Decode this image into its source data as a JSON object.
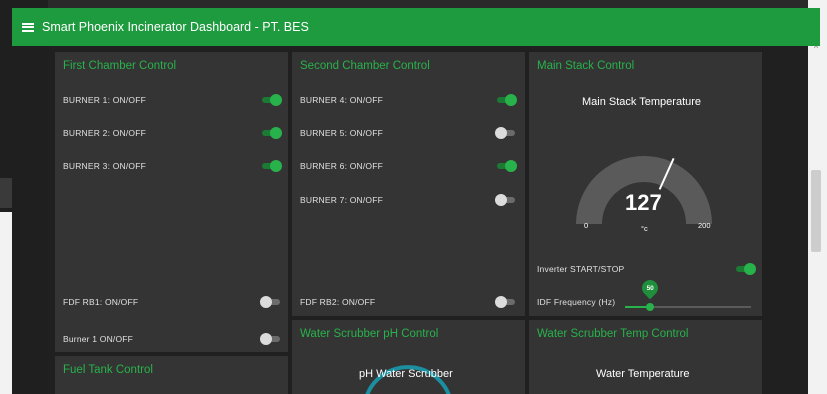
{
  "header": {
    "title": "Smart Phoenix Incinerator Dashboard - PT. BES"
  },
  "first_chamber": {
    "title": "First Chamber Control",
    "rows": [
      {
        "label": "BURNER 1: ON/OFF",
        "state": "on"
      },
      {
        "label": "BURNER 2: ON/OFF",
        "state": "on"
      },
      {
        "label": "BURNER 3: ON/OFF",
        "state": "on"
      },
      {
        "label": "FDF RB1: ON/OFF",
        "state": "off"
      },
      {
        "label": "Burner 1 ON/OFF",
        "state": "off"
      }
    ]
  },
  "second_chamber": {
    "title": "Second Chamber Control",
    "rows": [
      {
        "label": "BURNER 4: ON/OFF",
        "state": "on"
      },
      {
        "label": "BURNER 5: ON/OFF",
        "state": "off"
      },
      {
        "label": "BURNER 6: ON/OFF",
        "state": "on"
      },
      {
        "label": "BURNER 7: ON/OFF",
        "state": "off"
      },
      {
        "label": "FDF RB2: ON/OFF",
        "state": "off"
      }
    ]
  },
  "main_stack": {
    "title": "Main Stack Control",
    "gauge_title": "Main Stack Temperature",
    "value": "127",
    "unit": "°c",
    "min": "0",
    "max": "200",
    "inverter_label": "Inverter START/STOP",
    "inverter_state": "on",
    "idf_label": "IDF Frequency (Hz)",
    "idf_value": "50",
    "idf_fraction": 0.2
  },
  "fuel_tank": {
    "title": "Fuel Tank Control"
  },
  "water_ph": {
    "title": "Water Scrubber pH Control",
    "gauge_title": "pH Water Scrubber"
  },
  "water_temp": {
    "title": "Water Scrubber Temp Control",
    "gauge_title": "Water Temperature"
  },
  "colors": {
    "accent": "#28b24b",
    "header": "#1e9a3f",
    "card": "#343434",
    "gauge_fill": "#ffffff",
    "gauge_track": "#5a5a5a"
  }
}
